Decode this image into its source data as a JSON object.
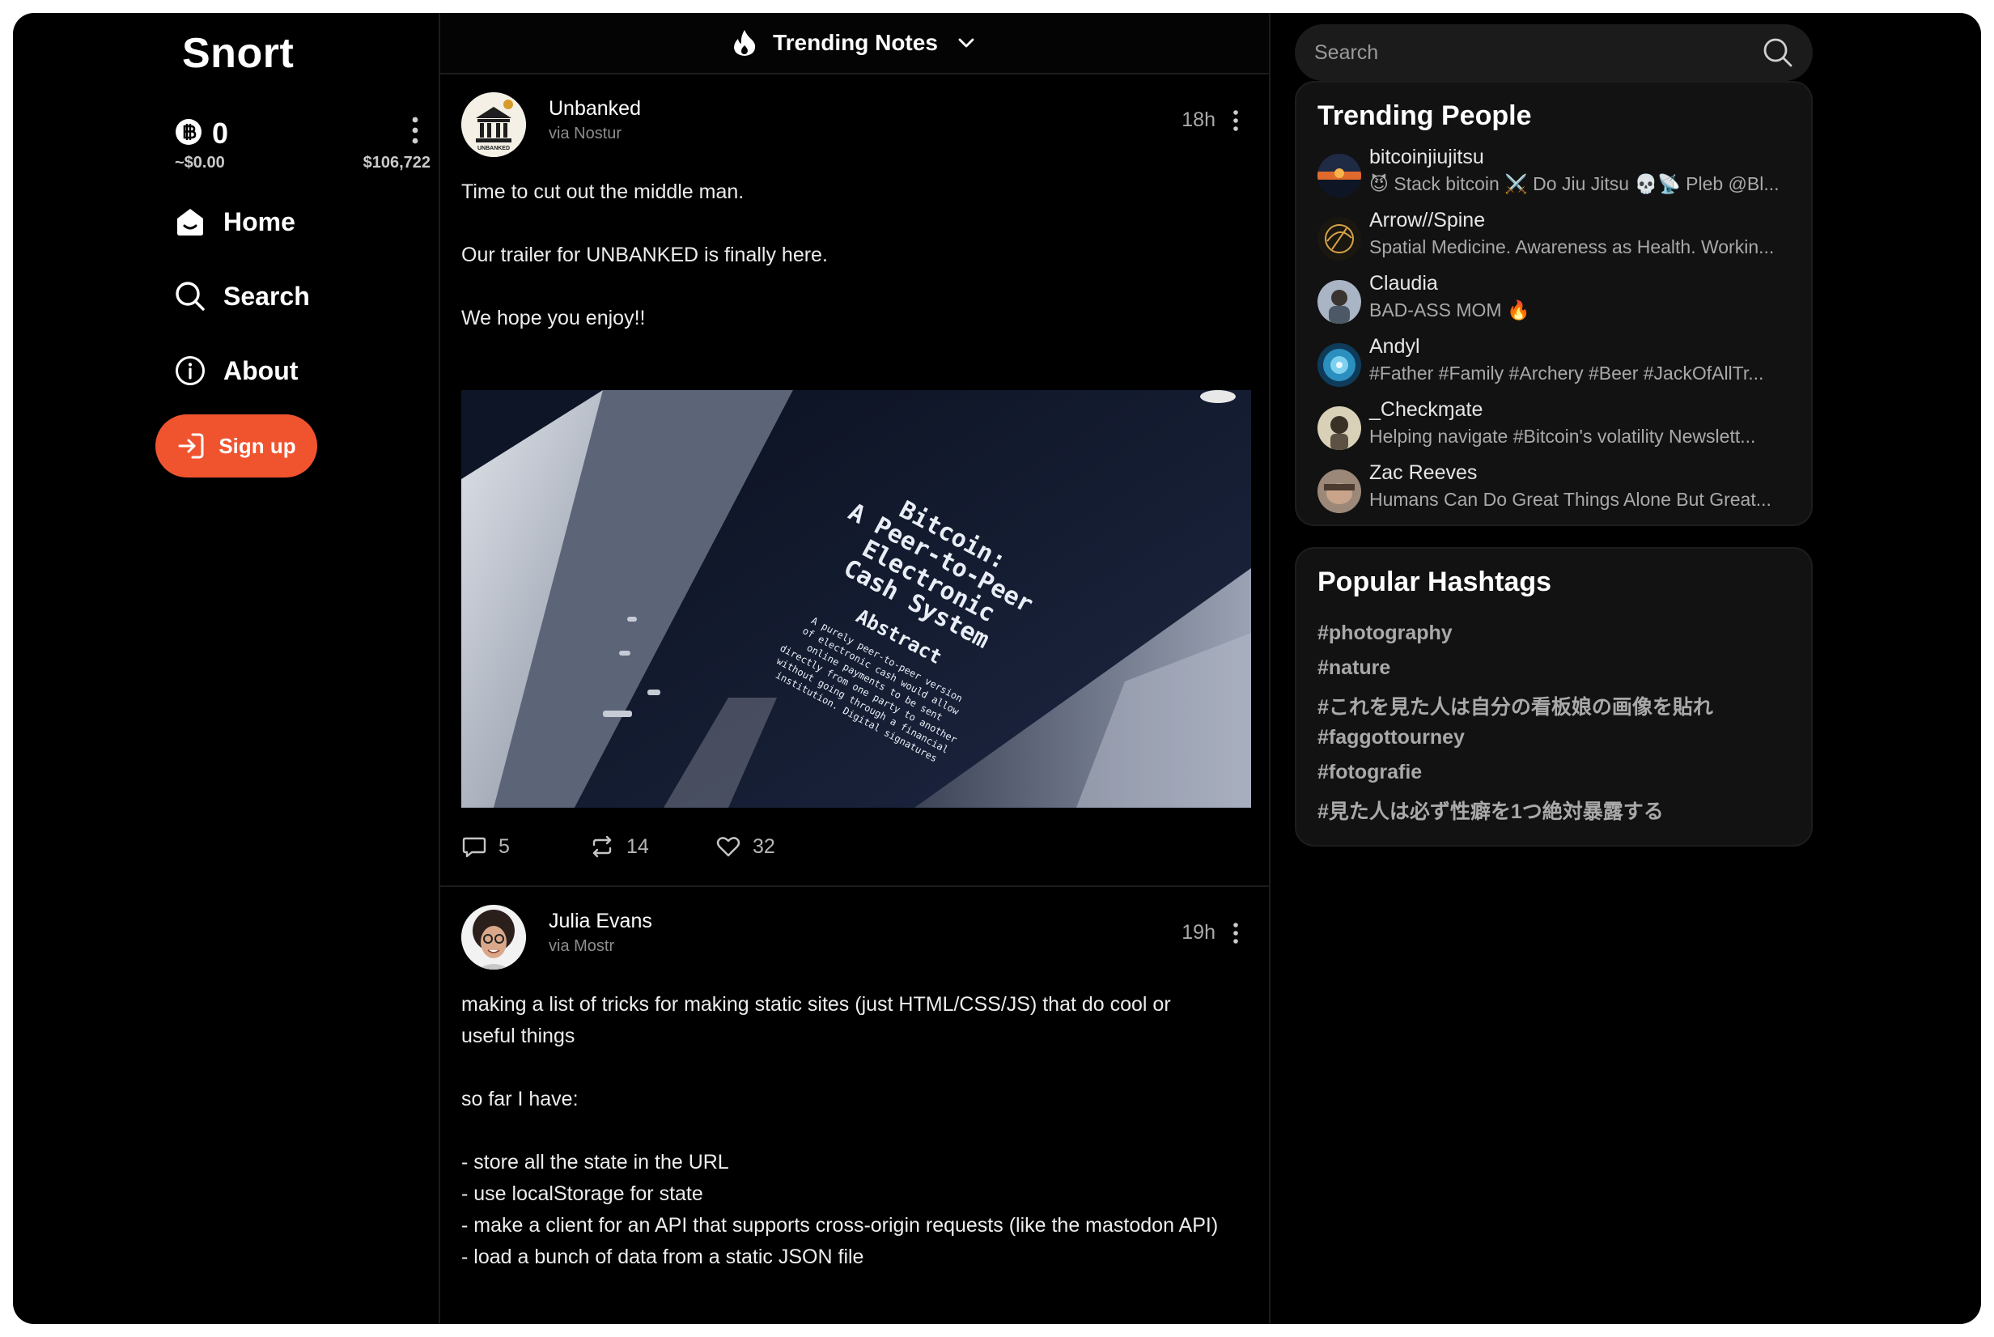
{
  "app": {
    "name": "Snort"
  },
  "wallet": {
    "balance": "0",
    "usd_value": "~$0.00",
    "btc_price": "$106,722",
    "icon": "bitcoin-coin-icon"
  },
  "nav": {
    "home": {
      "label": "Home",
      "icon": "home-icon"
    },
    "search": {
      "label": "Search",
      "icon": "search-icon"
    },
    "about": {
      "label": "About",
      "icon": "info-icon"
    }
  },
  "signup": {
    "label": "Sign up",
    "icon": "login-icon"
  },
  "feed": {
    "title": "Trending Notes",
    "notes": [
      {
        "author": "Unbanked",
        "via": "via Nostur",
        "time": "18h",
        "avatar_text": "UNBANKED",
        "body": [
          "Time to cut out the middle man.",
          "",
          "Our trailer for UNBANKED is finally here.",
          "",
          "We hope you enjoy!!"
        ],
        "image": {
          "title_lines": [
            "Bitcoin:",
            "A Peer-to-Peer",
            "Electronic",
            "Cash System"
          ],
          "abstract_label": "Abstract",
          "abstract_lines": [
            "A  purely  peer-to-peer  version",
            "of  electronic  cash  would  allow",
            "online  payments  to  be  sent",
            "directly  from  one  party  to  another",
            "without  going  through  a  financial",
            "institution.  Digital  signatures"
          ]
        },
        "replies": "5",
        "reposts": "14",
        "likes": "32"
      },
      {
        "author": "Julia Evans",
        "via": "via Mostr",
        "time": "19h",
        "body": [
          "making a list of tricks for making static sites (just HTML/CSS/JS) that do cool or useful things",
          "",
          "so far I have:",
          "",
          "- store all the state in the URL",
          "- use localStorage for state",
          "- make a client for an API that supports cross-origin requests (like the mastodon API)",
          "- load a bunch of data from a static JSON file"
        ]
      }
    ]
  },
  "search": {
    "placeholder": "Search"
  },
  "trending_people": {
    "title": "Trending People",
    "people": [
      {
        "name": "bitcoinjiujitsu",
        "bio": "😈 Stack bitcoin ⚔️ Do Jiu Jitsu 💀📡 Pleb @Bl...",
        "color": "#c2532d"
      },
      {
        "name": "Arrow//Spine",
        "bio": "Spatial Medicine. Awareness as Health. Workin...",
        "color": "#2a2416"
      },
      {
        "name": "Claudia",
        "bio": "BAD-ASS MOM 🔥",
        "color": "#6f7d92"
      },
      {
        "name": "Andyl",
        "bio": "#Father #Family #Archery #Beer #JackOfAllTr...",
        "color": "#2b8fbf"
      },
      {
        "name": "_Checkɱate",
        "bio": "Helping navigate #Bitcoin's volatility Newslett...",
        "color": "#b9ae8c"
      },
      {
        "name": "Zac Reeves",
        "bio": "Humans Can Do Great Things Alone But Great...",
        "color": "#8e7a6a"
      }
    ]
  },
  "popular_hashtags": {
    "title": "Popular Hashtags",
    "tags": [
      "#photography",
      "#nature",
      "#これを見た人は自分の看板娘の画像を貼れ",
      "#faggottourney",
      "#fotografie",
      "#見た人は必ず性癖を1つ絶対暴露する"
    ]
  },
  "colors": {
    "accent": "#f0542f",
    "background": "#000000",
    "panel": "#121212",
    "muted": "#a9a9a9"
  }
}
